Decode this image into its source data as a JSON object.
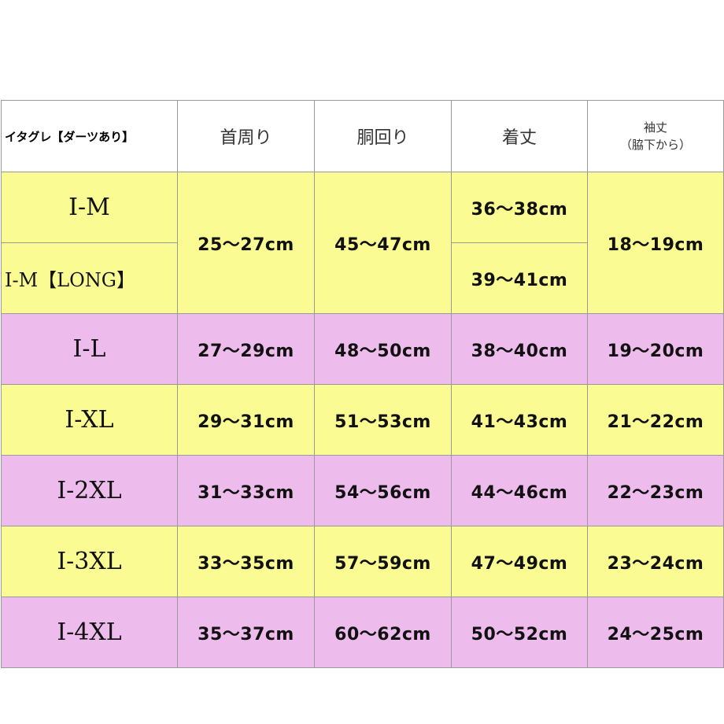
{
  "header": {
    "corner": "イタグレ【ダーツあり】",
    "neck": "首周り",
    "chest": "胴回り",
    "length": "着丈",
    "sleeve_line1": "袖丈",
    "sleeve_line2": "（脇下から）"
  },
  "colors": {
    "yellow_row": "#fafc93",
    "pink_row": "#eebcec",
    "border": "#9a9a9a"
  },
  "rows": [
    {
      "size": "I-M",
      "neck": "25〜27cm",
      "chest": "45〜47cm",
      "length": "36〜38cm",
      "sleeve": "18〜19cm"
    },
    {
      "size": "I-M【LONG】",
      "length": "39〜41cm"
    },
    {
      "size": "I-L",
      "neck": "27〜29cm",
      "chest": "48〜50cm",
      "length": "38〜40cm",
      "sleeve": "19〜20cm"
    },
    {
      "size": "I-XL",
      "neck": "29〜31cm",
      "chest": "51〜53cm",
      "length": "41〜43cm",
      "sleeve": "21〜22cm"
    },
    {
      "size": "I-2XL",
      "neck": "31〜33cm",
      "chest": "54〜56cm",
      "length": "44〜46cm",
      "sleeve": "22〜23cm"
    },
    {
      "size": "I-3XL",
      "neck": "33〜35cm",
      "chest": "57〜59cm",
      "length": "47〜49cm",
      "sleeve": "23〜24cm"
    },
    {
      "size": "I-4XL",
      "neck": "35〜37cm",
      "chest": "60〜62cm",
      "length": "50〜52cm",
      "sleeve": "24〜25cm"
    }
  ]
}
